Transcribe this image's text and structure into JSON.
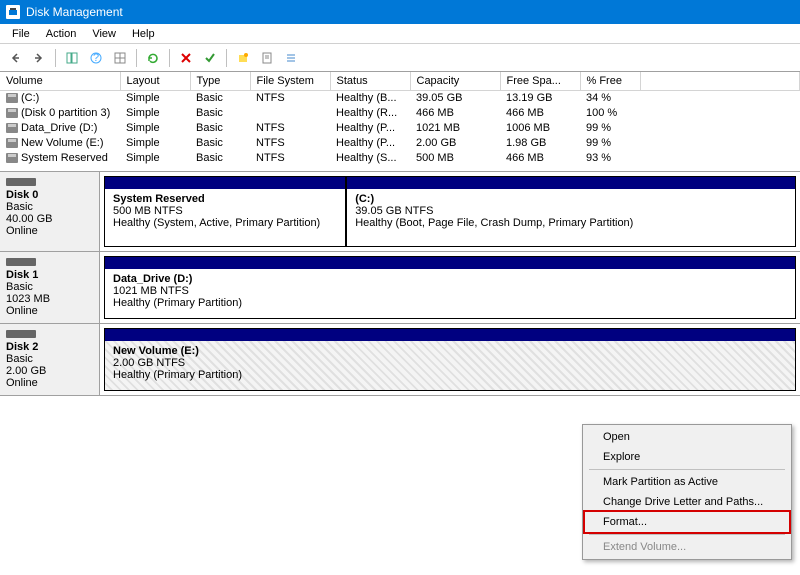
{
  "title": "Disk Management",
  "menu": [
    "File",
    "Action",
    "View",
    "Help"
  ],
  "columns": [
    "Volume",
    "Layout",
    "Type",
    "File System",
    "Status",
    "Capacity",
    "Free Spa...",
    "% Free"
  ],
  "volumes": [
    {
      "name": "(C:)",
      "layout": "Simple",
      "type": "Basic",
      "fs": "NTFS",
      "status": "Healthy (B...",
      "cap": "39.05 GB",
      "free": "13.19 GB",
      "pct": "34 %"
    },
    {
      "name": "(Disk 0 partition 3)",
      "layout": "Simple",
      "type": "Basic",
      "fs": "",
      "status": "Healthy (R...",
      "cap": "466 MB",
      "free": "466 MB",
      "pct": "100 %"
    },
    {
      "name": "Data_Drive (D:)",
      "layout": "Simple",
      "type": "Basic",
      "fs": "NTFS",
      "status": "Healthy (P...",
      "cap": "1021 MB",
      "free": "1006 MB",
      "pct": "99 %"
    },
    {
      "name": "New Volume (E:)",
      "layout": "Simple",
      "type": "Basic",
      "fs": "NTFS",
      "status": "Healthy (P...",
      "cap": "2.00 GB",
      "free": "1.98 GB",
      "pct": "99 %"
    },
    {
      "name": "System Reserved",
      "layout": "Simple",
      "type": "Basic",
      "fs": "NTFS",
      "status": "Healthy (S...",
      "cap": "500 MB",
      "free": "466 MB",
      "pct": "93 %"
    }
  ],
  "disks": [
    {
      "name": "Disk 0",
      "type": "Basic",
      "size": "40.00 GB",
      "state": "Online",
      "parts": [
        {
          "title": "System Reserved",
          "sub": "500 MB NTFS",
          "desc": "Healthy (System, Active, Primary Partition)",
          "flex": "0 0 35%"
        },
        {
          "title": "(C:)",
          "sub": "39.05 GB NTFS",
          "desc": "Healthy (Boot, Page File, Crash Dump, Primary Partition)",
          "flex": "1"
        }
      ]
    },
    {
      "name": "Disk 1",
      "type": "Basic",
      "size": "1023 MB",
      "state": "Online",
      "parts": [
        {
          "title": "Data_Drive  (D:)",
          "sub": "1021 MB NTFS",
          "desc": "Healthy (Primary Partition)",
          "flex": "1"
        }
      ]
    },
    {
      "name": "Disk 2",
      "type": "Basic",
      "size": "2.00 GB",
      "state": "Online",
      "parts": [
        {
          "title": "New Volume  (E:)",
          "sub": "2.00 GB NTFS",
          "desc": "Healthy (Primary Partition)",
          "flex": "1",
          "hatch": true
        }
      ]
    }
  ],
  "context": {
    "open": "Open",
    "explore": "Explore",
    "mark": "Mark Partition as Active",
    "change": "Change Drive Letter and Paths...",
    "format": "Format...",
    "extend": "Extend Volume..."
  }
}
